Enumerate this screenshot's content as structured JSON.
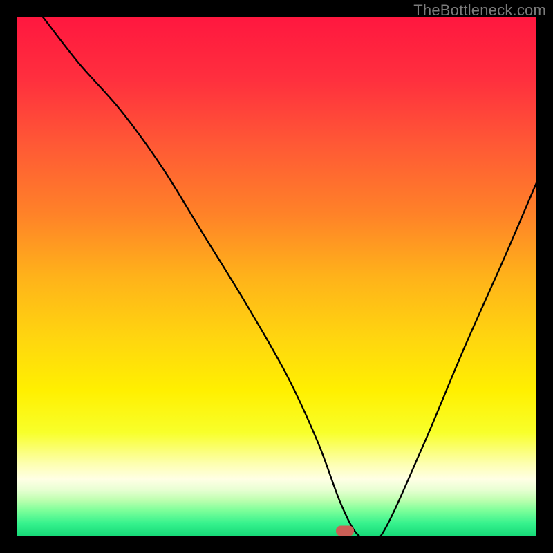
{
  "watermark": "TheBottleneck.com",
  "chart_data": {
    "type": "line",
    "title": "",
    "xlabel": "",
    "ylabel": "",
    "xlim": [
      0,
      100
    ],
    "ylim": [
      0,
      100
    ],
    "grid": false,
    "series": [
      {
        "name": "bottleneck-curve",
        "x": [
          5,
          12,
          20,
          28,
          36,
          44,
          52,
          58,
          62.5,
          66,
          70,
          78,
          86,
          94,
          100
        ],
        "y": [
          100,
          91,
          82,
          71,
          58,
          45,
          31,
          18,
          6,
          0,
          0,
          17,
          36,
          54,
          68
        ]
      }
    ],
    "gradient_stops": [
      {
        "pos": 0.0,
        "color": "#ff173f"
      },
      {
        "pos": 0.12,
        "color": "#ff2f3e"
      },
      {
        "pos": 0.25,
        "color": "#ff5a35"
      },
      {
        "pos": 0.38,
        "color": "#ff8228"
      },
      {
        "pos": 0.5,
        "color": "#ffb21a"
      },
      {
        "pos": 0.62,
        "color": "#ffd60f"
      },
      {
        "pos": 0.72,
        "color": "#fff000"
      },
      {
        "pos": 0.8,
        "color": "#f8ff2a"
      },
      {
        "pos": 0.86,
        "color": "#fdffb0"
      },
      {
        "pos": 0.89,
        "color": "#ffffe5"
      },
      {
        "pos": 0.91,
        "color": "#e8ffd3"
      },
      {
        "pos": 0.93,
        "color": "#beffb0"
      },
      {
        "pos": 0.95,
        "color": "#7dff9a"
      },
      {
        "pos": 0.975,
        "color": "#36f28d"
      },
      {
        "pos": 1.0,
        "color": "#15d977"
      }
    ],
    "marker": {
      "x_pct": 63.2,
      "y_pct": 99.0,
      "color": "#cb5f56"
    }
  }
}
